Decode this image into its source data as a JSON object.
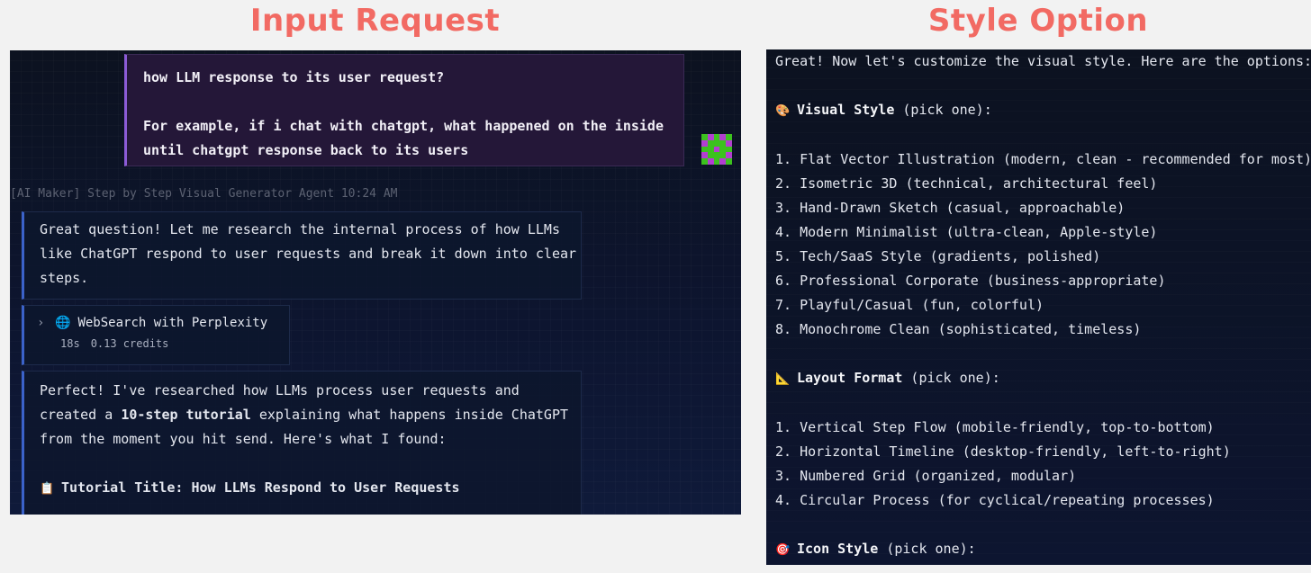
{
  "headings": {
    "left": "Input Request",
    "right": "Style Option"
  },
  "user_message": {
    "line1": "how LLM response to its user request?",
    "line2": "For example, if i chat with chatgpt, what happened on the inside",
    "line3": "until chatgpt response back to its users"
  },
  "agent_header": "[AI Maker] Step by Step Visual Generator Agent 10:24 AM",
  "agent_reply_1": {
    "line1": "Great question! Let me research the internal process of how LLMs",
    "line2": "like ChatGPT respond to user requests and break it down into clear",
    "line3": "steps."
  },
  "tool_call": {
    "chevron_icon": "chevron-right-icon",
    "icon": "globe-icon",
    "label": "WebSearch with Perplexity",
    "duration": "18s",
    "credits": "0.13 credits"
  },
  "agent_reply_2": {
    "l1": "Perfect! I've researched how LLMs process user requests and",
    "l2_pre": "created a ",
    "l2_bold": "10-step tutorial",
    "l2_post": " explaining what happens inside ChatGPT",
    "l3": "from the moment you hit send. Here's what I found:",
    "title_icon": "clipboard-icon",
    "title": "Tutorial Title: How LLMs Respond to User Requests"
  },
  "style_options": {
    "intro": "Great! Now let's customize the visual style. Here are the options:",
    "visual": {
      "icon": "palette-icon",
      "title": "Visual Style",
      "note": " (pick one):",
      "items": [
        "1. Flat Vector Illustration (modern, clean - recommended for most)",
        "2. Isometric 3D (technical, architectural feel)",
        "3. Hand-Drawn Sketch (casual, approachable)",
        "4. Modern Minimalist (ultra-clean, Apple-style)",
        "5. Tech/SaaS Style (gradients, polished)",
        "6. Professional Corporate (business-appropriate)",
        "7. Playful/Casual (fun, colorful)",
        "8. Monochrome Clean (sophisticated, timeless)"
      ]
    },
    "layout": {
      "icon": "triangular-ruler-icon",
      "title": "Layout Format",
      "note": " (pick one):",
      "items": [
        "1. Vertical Step Flow (mobile-friendly, top-to-bottom)",
        "2. Horizontal Timeline (desktop-friendly, left-to-right)",
        "3. Numbered Grid (organized, modular)",
        "4. Circular Process (for cyclical/repeating processes)"
      ]
    },
    "icon_style": {
      "icon": "target-icon",
      "title": "Icon Style",
      "note": " (pick one):"
    }
  },
  "colors": {
    "heading": "#f26a63",
    "user_accent": "#8b5bd6",
    "agent_accent": "#3b62c9",
    "panel_bg": "#0d1530"
  }
}
